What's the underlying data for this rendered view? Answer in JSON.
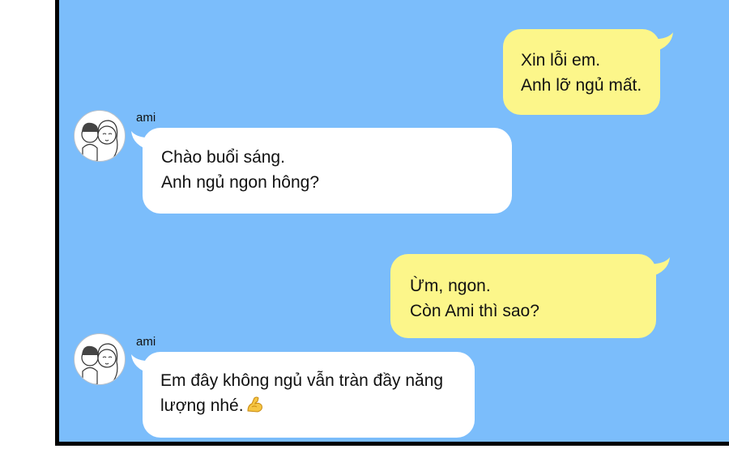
{
  "chat": {
    "messages": [
      {
        "side": "right",
        "color": "yellow",
        "lines": [
          "Xin lỗi em.",
          "Anh lỡ ngủ mất."
        ]
      },
      {
        "side": "left",
        "color": "white",
        "sender": "ami",
        "lines": [
          "Chào buổi sáng.",
          "Anh ngủ ngon hông?"
        ]
      },
      {
        "side": "right",
        "color": "yellow",
        "lines": [
          "Ừm, ngon.",
          "Còn Ami thì sao?"
        ]
      },
      {
        "side": "left",
        "color": "white",
        "sender": "ami",
        "lines": [
          "Em đây không ngủ vẫn tràn đầy năng",
          "lượng nhé."
        ],
        "emoji": "flexed-biceps-icon"
      }
    ]
  },
  "colors": {
    "background": "#7bbdfb",
    "outgoing_bubble": "#fcf68a",
    "incoming_bubble": "#ffffff"
  }
}
